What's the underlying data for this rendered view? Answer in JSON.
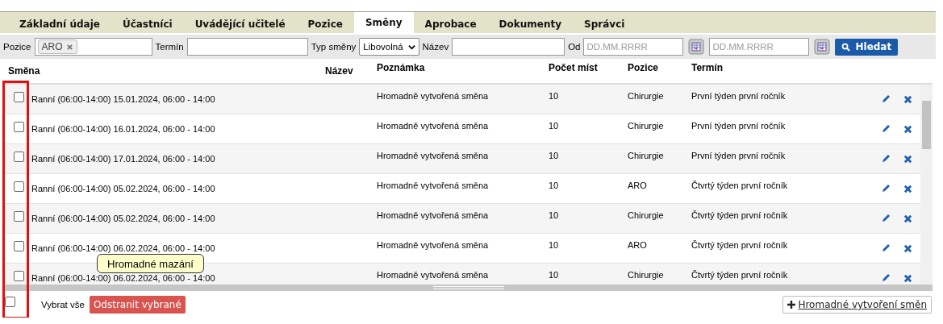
{
  "tabs": [
    {
      "label": "Základní údaje",
      "selected": false
    },
    {
      "label": "Účastníci",
      "selected": false
    },
    {
      "label": "Uvádějící učitelé",
      "selected": false
    },
    {
      "label": "Pozice",
      "selected": false
    },
    {
      "label": "Směny",
      "selected": true
    },
    {
      "label": "Aprobace",
      "selected": false
    },
    {
      "label": "Dokumenty",
      "selected": false
    },
    {
      "label": "Správci",
      "selected": false
    }
  ],
  "filters": {
    "position_label": "Pozice",
    "position_tags": [
      "ARO"
    ],
    "term_label": "Termín",
    "shift_type_label": "Typ směny",
    "shift_type_value": "Libovolná",
    "name_label": "Název",
    "from_label": "Od",
    "from_placeholder": "DD.MM.RRRR",
    "to_placeholder": "DD.MM.RRRR",
    "search_button": "Hledat"
  },
  "table": {
    "columns": [
      "Směna",
      "Název",
      "Poznámka",
      "Počet míst",
      "Pozice",
      "Termín"
    ],
    "rows": [
      {
        "checked": false,
        "shift": "Ranní (06:00-14:00) 15.01.2024, 06:00 - 14:00",
        "note": "Hromadně vytvořená směna",
        "places": "10",
        "position": "Chirurgie",
        "term": "První týden první ročník"
      },
      {
        "checked": false,
        "shift": "Ranní (06:00-14:00) 16.01.2024, 06:00 - 14:00",
        "note": "Hromadně vytvořená směna",
        "places": "10",
        "position": "Chirurgie",
        "term": "První týden první ročník"
      },
      {
        "checked": false,
        "shift": "Ranní (06:00-14:00) 17.01.2024, 06:00 - 14:00",
        "note": "Hromadně vytvořená směna",
        "places": "10",
        "position": "Chirurgie",
        "term": "První týden první ročník"
      },
      {
        "checked": false,
        "shift": "Ranní (06:00-14:00) 05.02.2024, 06:00 - 14:00",
        "note": "Hromadně vytvořená směna",
        "places": "10",
        "position": "ARO",
        "term": "Čtvrtý týden první ročník"
      },
      {
        "checked": false,
        "shift": "Ranní (06:00-14:00) 05.02.2024, 06:00 - 14:00",
        "note": "Hromadně vytvořená směna",
        "places": "10",
        "position": "Chirurgie",
        "term": "Čtvrtý týden první ročník"
      },
      {
        "checked": false,
        "shift": "Ranní (06:00-14:00) 06.02.2024, 06:00 - 14:00",
        "note": "Hromadně vytvořená směna",
        "places": "10",
        "position": "ARO",
        "term": "Čtvrtý týden první ročník"
      },
      {
        "checked": false,
        "shift": "Ranní (06:00-14:00) 06.02.2024, 06:00 - 14:00",
        "note": "Hromadně vytvořená směna",
        "places": "10",
        "position": "Chirurgie",
        "term": "Čtvrtý týden první ročník"
      }
    ]
  },
  "footer": {
    "select_all_checked": false,
    "select_all_label": "Vybrat vše",
    "delete_button": "Odstranit vybrané",
    "bulk_create_link": "Hromadné vytvoření směn"
  },
  "tooltip": "Hromadné mazání"
}
